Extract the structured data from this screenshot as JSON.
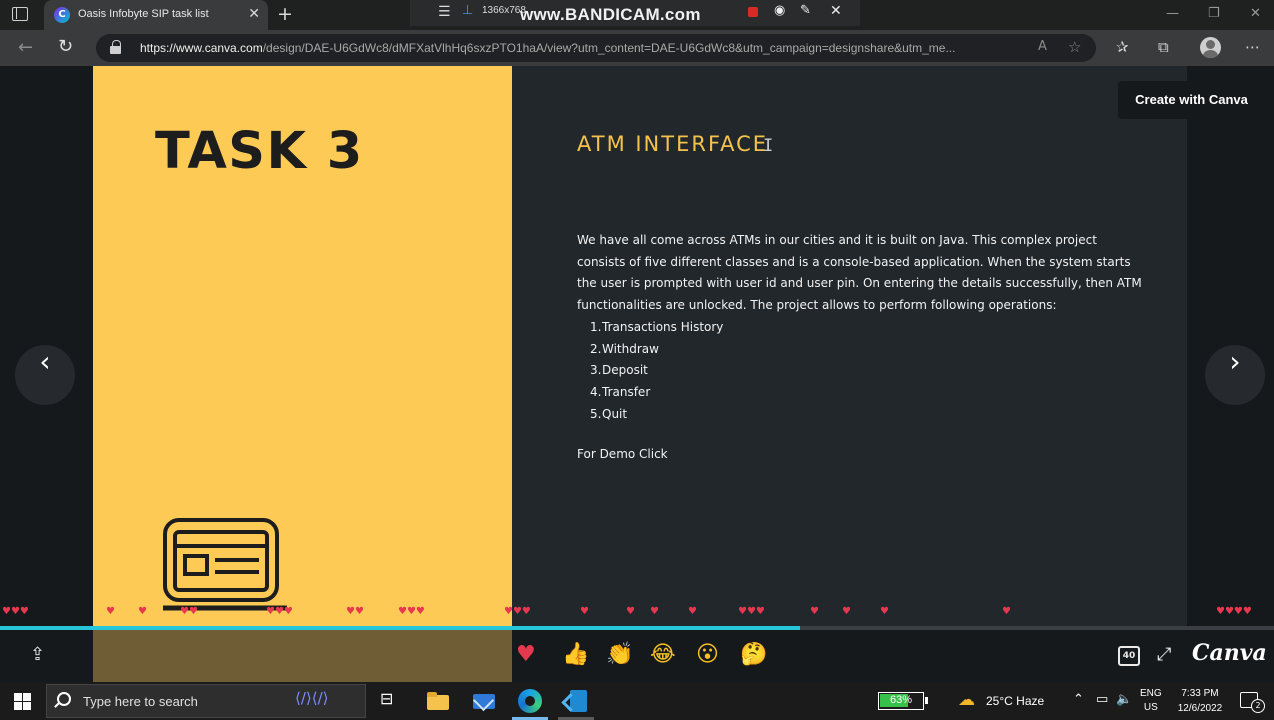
{
  "browser": {
    "tab_title": "Oasis Infobyte SIP task list",
    "favicon_letter": "C",
    "url_host": "https://www.canva.com",
    "url_path": "/design/DAE-U6GdWc8/dMFXatVlhHq6sxzPTO1haA/view?utm_content=DAE-U6GdWc8&utm_campaign=designshare&utm_me..."
  },
  "bandicam": {
    "resolution": "1366x768",
    "watermark": "www.BANDICAM.com"
  },
  "slide": {
    "task_title": "TASK 3",
    "heading": "ATM INTERFACE",
    "description": "We have all come across ATMs in our cities and it is built on Java. This complex project consists of five different classes and is a console-based application. When the system starts the user is prompted with user id and user pin. On entering the details successfully, then ATM functionalities are unlocked. The project allows to perform following operations:",
    "operations": [
      {
        "num": "1.",
        "label": "Transactions History"
      },
      {
        "num": "2.",
        "label": "Withdraw"
      },
      {
        "num": "3.",
        "label": "Deposit"
      },
      {
        "num": "4.",
        "label": "Transfer"
      },
      {
        "num": "5.",
        "label": "Quit"
      }
    ],
    "demo_text": "For Demo Click"
  },
  "viewer": {
    "create_button": "Create with Canva",
    "prev_glyph": "‹",
    "next_glyph": "›",
    "page_badge": "40",
    "logo": "Canva",
    "progress": 0.628
  },
  "taskbar": {
    "search_placeholder": "Type here to search",
    "battery_label": "63%",
    "battery_level": 0.63,
    "weather": "25°C  Haze",
    "lang_line1": "ENG",
    "lang_line2": "US",
    "time": "7:33 PM",
    "date": "12/6/2022",
    "notification_count": "2"
  },
  "colors": {
    "slide_yellow": "#fdca56",
    "slide_dark": "#22272b",
    "heading_gold": "#f4c24d",
    "progress_cyan": "#26c6d8"
  }
}
